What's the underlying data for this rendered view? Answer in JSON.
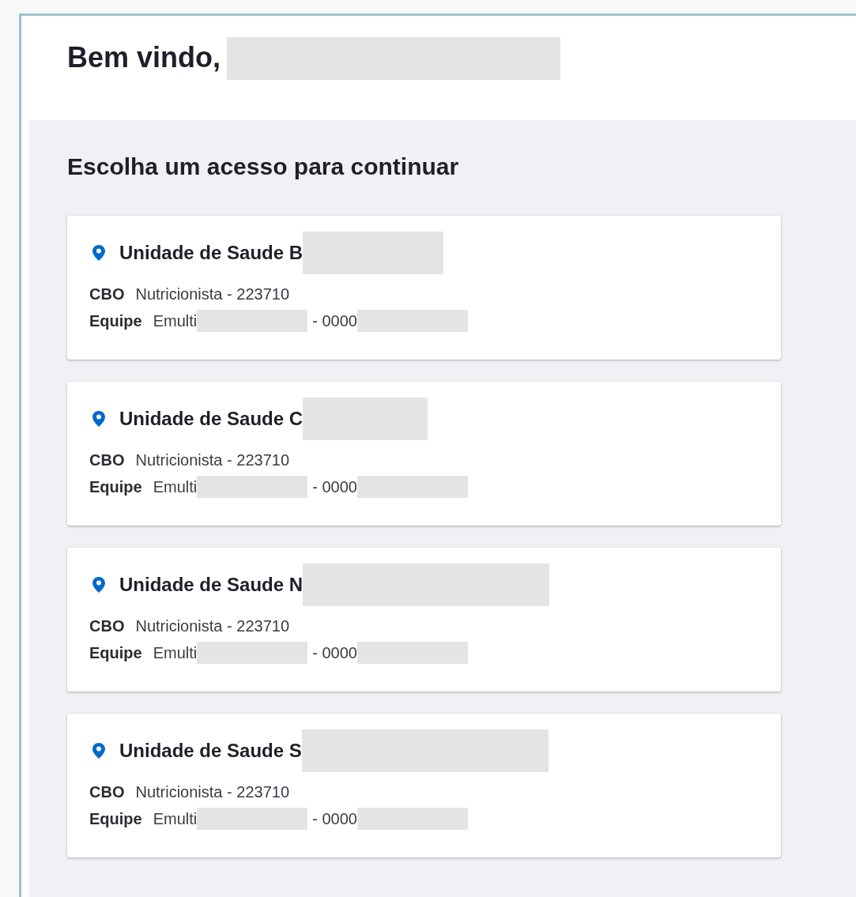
{
  "header": {
    "greeting": "Bem vindo,"
  },
  "section": {
    "title": "Escolha um acesso para continuar"
  },
  "access_cards": [
    {
      "unit": "Unidade de Saude B",
      "cbo_label": "CBO",
      "cbo_value": "Nutricionista - 223710",
      "team_label": "Equipe",
      "team_prefix": "Emulti",
      "team_code": "- 0000"
    },
    {
      "unit": "Unidade de Saude C",
      "cbo_label": "CBO",
      "cbo_value": "Nutricionista - 223710",
      "team_label": "Equipe",
      "team_prefix": "Emulti",
      "team_code": "- 0000"
    },
    {
      "unit": "Unidade de Saude N",
      "cbo_label": "CBO",
      "cbo_value": "Nutricionista - 223710",
      "team_label": "Equipe",
      "team_prefix": "Emulti",
      "team_code": "- 0000"
    },
    {
      "unit": "Unidade de Saude S",
      "cbo_label": "CBO",
      "cbo_value": "Nutricionista - 223710",
      "team_label": "Equipe",
      "team_prefix": "Emulti",
      "team_code": "- 0000"
    }
  ]
}
